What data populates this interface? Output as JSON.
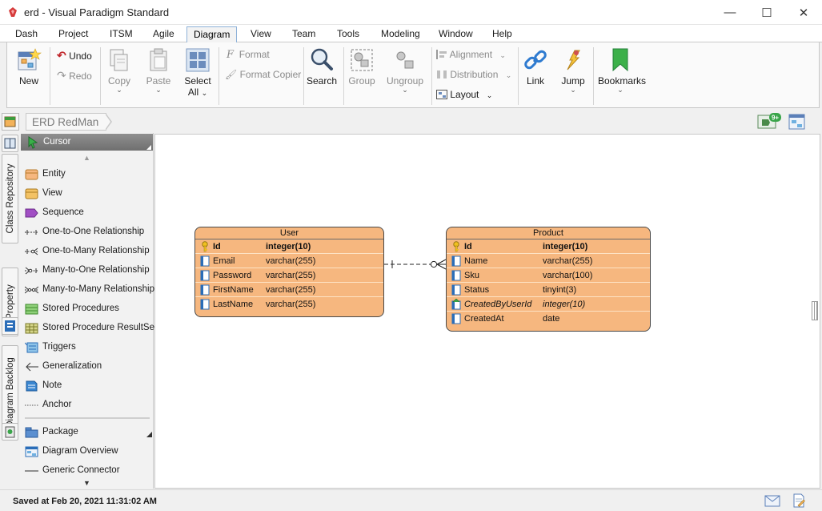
{
  "window": {
    "title": "erd - Visual Paradigm Standard",
    "minimize": "—",
    "maximize": "☐",
    "close": "✕"
  },
  "menu": {
    "tabs": [
      "Dash",
      "Project",
      "ITSM",
      "Agile",
      "Diagram",
      "View",
      "Team",
      "Tools",
      "Modeling",
      "Window",
      "Help"
    ],
    "active": "Diagram"
  },
  "ribbon": {
    "new": "New",
    "undo": "Undo",
    "redo": "Redo",
    "copy": "Copy",
    "paste": "Paste",
    "select_all_1": "Select",
    "select_all_2": "All",
    "format": "Format",
    "format_copier": "Format Copier",
    "search": "Search",
    "group": "Group",
    "ungroup": "Ungroup",
    "alignment": "Alignment",
    "distribution": "Distribution",
    "layout": "Layout",
    "link": "Link",
    "jump": "Jump",
    "bookmarks": "Bookmarks",
    "notification_badge": "9+"
  },
  "breadcrumb": "ERD RedMan",
  "side_tabs": [
    "Class Repository",
    "Property",
    "Diagram Backlog"
  ],
  "palette": {
    "cursor": "Cursor",
    "items": [
      {
        "label": "Entity",
        "icon": "entity-icon"
      },
      {
        "label": "View",
        "icon": "view-icon"
      },
      {
        "label": "Sequence",
        "icon": "sequence-icon"
      },
      {
        "label": "One-to-One Relationship",
        "icon": "one-to-one-icon"
      },
      {
        "label": "One-to-Many Relationship",
        "icon": "one-to-many-icon"
      },
      {
        "label": "Many-to-One Relationship",
        "icon": "many-to-one-icon"
      },
      {
        "label": "Many-to-Many Relationship",
        "icon": "many-to-many-icon"
      },
      {
        "label": "Stored Procedures",
        "icon": "stored-procedures-icon"
      },
      {
        "label": "Stored Procedure ResultSet",
        "icon": "resultset-icon"
      },
      {
        "label": "Triggers",
        "icon": "triggers-icon"
      },
      {
        "label": "Generalization",
        "icon": "generalization-icon"
      },
      {
        "label": "Note",
        "icon": "note-icon"
      },
      {
        "label": "Anchor",
        "icon": "anchor-icon"
      }
    ],
    "items2": [
      {
        "label": "Package",
        "icon": "package-icon"
      },
      {
        "label": "Diagram Overview",
        "icon": "diagram-overview-icon"
      },
      {
        "label": "Generic Connector",
        "icon": "generic-connector-icon"
      }
    ]
  },
  "entities": {
    "user": {
      "name": "User",
      "columns": [
        {
          "name": "Id",
          "type": "integer(10)",
          "kind": "pk"
        },
        {
          "name": "Email",
          "type": "varchar(255)",
          "kind": "col"
        },
        {
          "name": "Password",
          "type": "varchar(255)",
          "kind": "col"
        },
        {
          "name": "FirstName",
          "type": "varchar(255)",
          "kind": "col"
        },
        {
          "name": "LastName",
          "type": "varchar(255)",
          "kind": "col"
        }
      ]
    },
    "product": {
      "name": "Product",
      "columns": [
        {
          "name": "Id",
          "type": "integer(10)",
          "kind": "pk"
        },
        {
          "name": "Name",
          "type": "varchar(255)",
          "kind": "col"
        },
        {
          "name": "Sku",
          "type": "varchar(100)",
          "kind": "col"
        },
        {
          "name": "Status",
          "type": "tinyint(3)",
          "kind": "col"
        },
        {
          "name": "CreatedByUserId",
          "type": "integer(10)",
          "kind": "fk"
        },
        {
          "name": "CreatedAt",
          "type": "date",
          "kind": "col"
        }
      ]
    }
  },
  "status": {
    "message": "Saved at Feb 20, 2021 11:31:02 AM"
  },
  "colors": {
    "entity_fill": "#f6b77f",
    "accent": "#8fb2d8"
  }
}
